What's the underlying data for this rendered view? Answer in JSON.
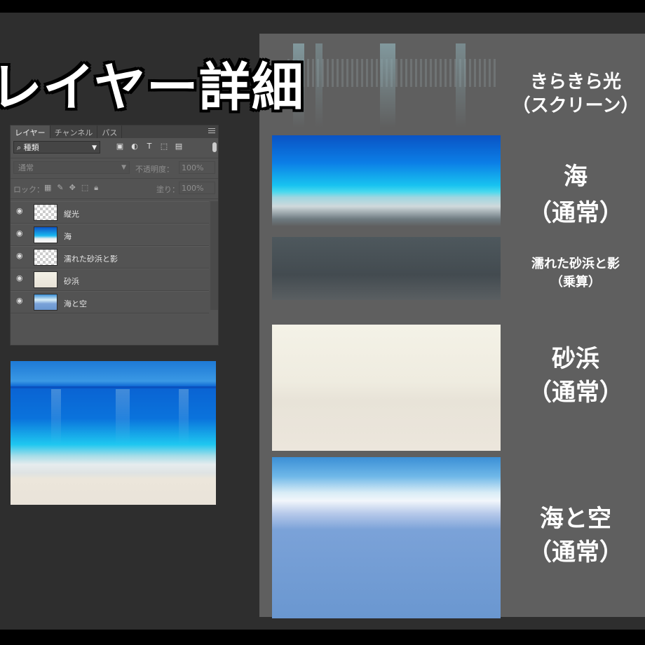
{
  "title": "レイヤー詳細",
  "layers_panel": {
    "tabs": [
      "レイヤー",
      "チャンネル",
      "パス"
    ],
    "kind_filter": "種類",
    "blend_mode": "通常",
    "opacity_label": "不透明度：",
    "opacity_value": "100%",
    "lock_label": "ロック：",
    "fill_label": "塗り：",
    "fill_value": "100%",
    "layers": [
      {
        "name": "縦光",
        "thumb": "transparent"
      },
      {
        "name": "海",
        "thumb": "sea"
      },
      {
        "name": "濡れた砂浜と影",
        "thumb": "transparent"
      },
      {
        "name": "砂浜",
        "thumb": "sand"
      },
      {
        "name": "海と空",
        "thumb": "sky"
      }
    ]
  },
  "layer_details": [
    {
      "name": "きらきら光",
      "mode": "（スクリーン）"
    },
    {
      "name": "海",
      "mode": "（通常）"
    },
    {
      "name": "濡れた砂浜と影",
      "mode": "（乗算）"
    },
    {
      "name": "砂浜",
      "mode": "（通常）"
    },
    {
      "name": "海と空",
      "mode": "（通常）"
    }
  ],
  "colors": {
    "background": "#2e2e2e",
    "right_panel": "#5f5f5f",
    "ps_panel": "#535353",
    "sea_blue": "#0b7ee6",
    "sand": "#efece0",
    "sky_blue": "#6a97d0"
  },
  "icons": {
    "filter": [
      "image-filter-icon",
      "adjustment-filter-icon",
      "type-filter-icon",
      "shape-filter-icon",
      "smart-object-filter-icon"
    ],
    "lock": [
      "lock-transparent-icon",
      "lock-paint-icon",
      "lock-move-icon",
      "lock-artboard-icon",
      "lock-all-icon"
    ]
  }
}
